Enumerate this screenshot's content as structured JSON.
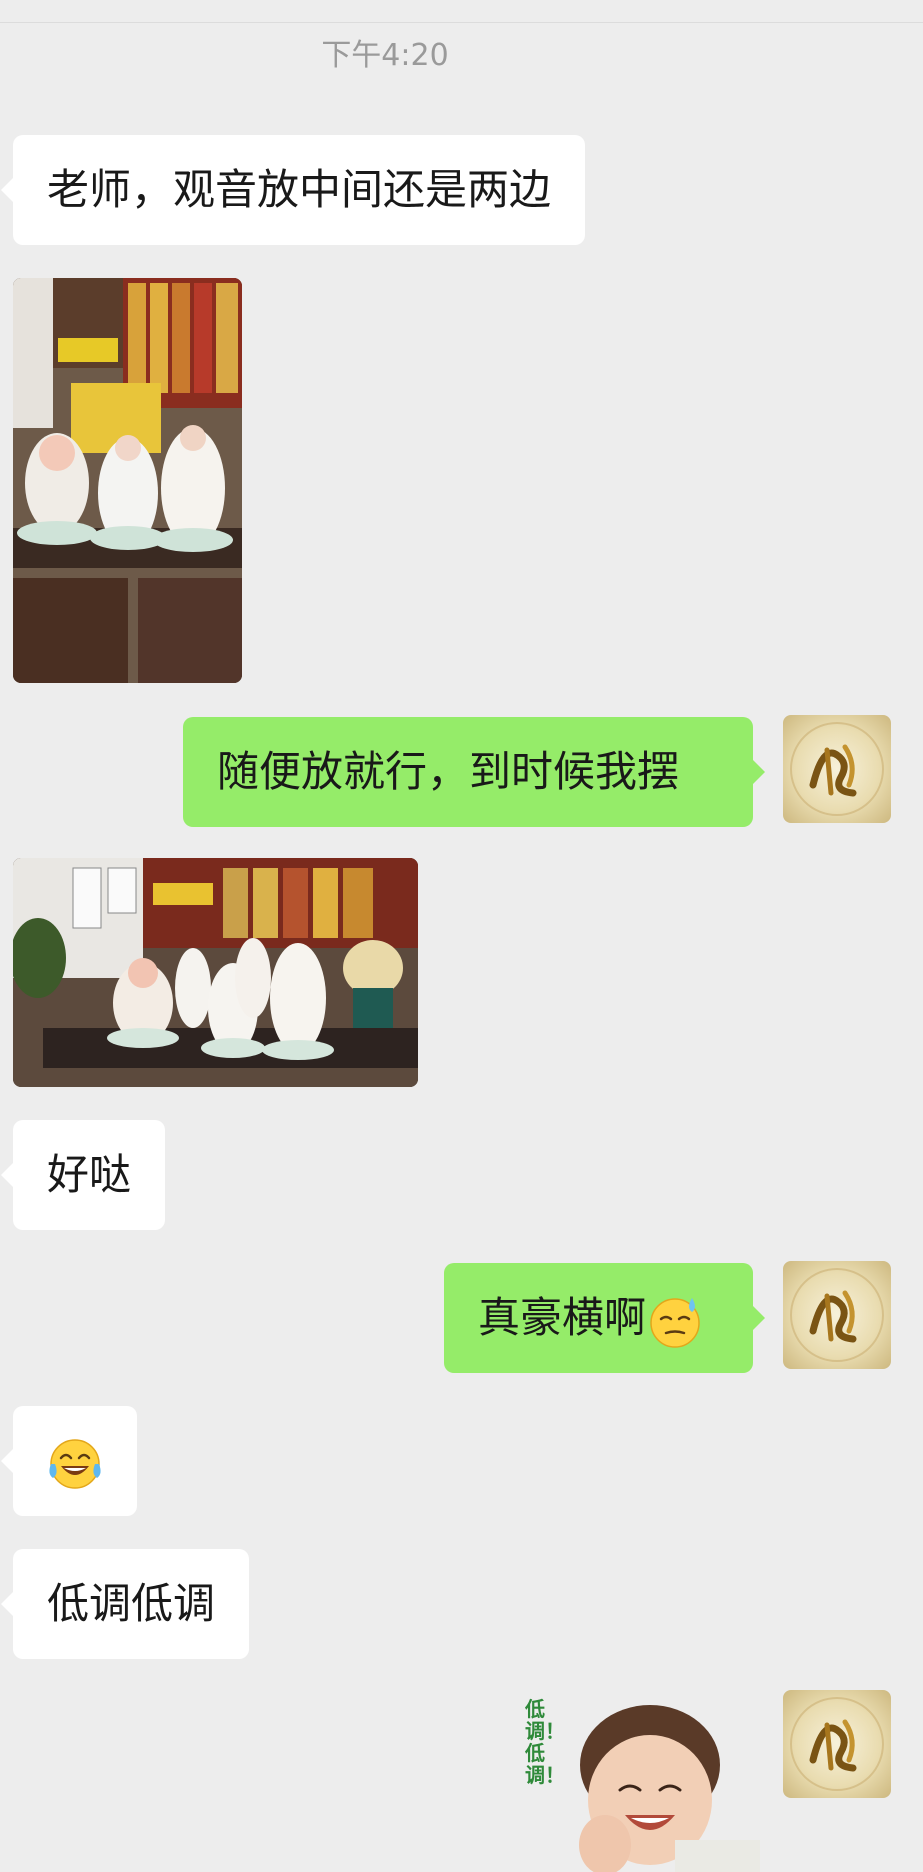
{
  "chat": {
    "timestamp": "下午4:20",
    "messages": [
      {
        "side": "left",
        "type": "text",
        "text": "老师，观音放中间还是两边"
      },
      {
        "side": "left",
        "type": "image",
        "description": "photo"
      },
      {
        "side": "right",
        "type": "text",
        "text": "随便放就行，到时候我摆"
      },
      {
        "side": "left",
        "type": "image",
        "description": "photo"
      },
      {
        "side": "left",
        "type": "text",
        "text": "好哒"
      },
      {
        "side": "right",
        "type": "text",
        "text": "真豪横啊",
        "emoji": "sweat-smile-emoji"
      },
      {
        "side": "left",
        "type": "emoji",
        "emoji": "tears-of-joy-emoji"
      },
      {
        "side": "left",
        "type": "text",
        "text": "低调低调"
      },
      {
        "side": "right",
        "type": "sticker",
        "caption": "低调！低调！"
      }
    ]
  },
  "colors": {
    "background": "#ededed",
    "self_bubble": "#95ec69",
    "other_bubble": "#ffffff",
    "timestamp_text": "#9a9a9a"
  },
  "avatar": {
    "icon": "calligraphy-avatar-icon",
    "glyph": "福"
  }
}
